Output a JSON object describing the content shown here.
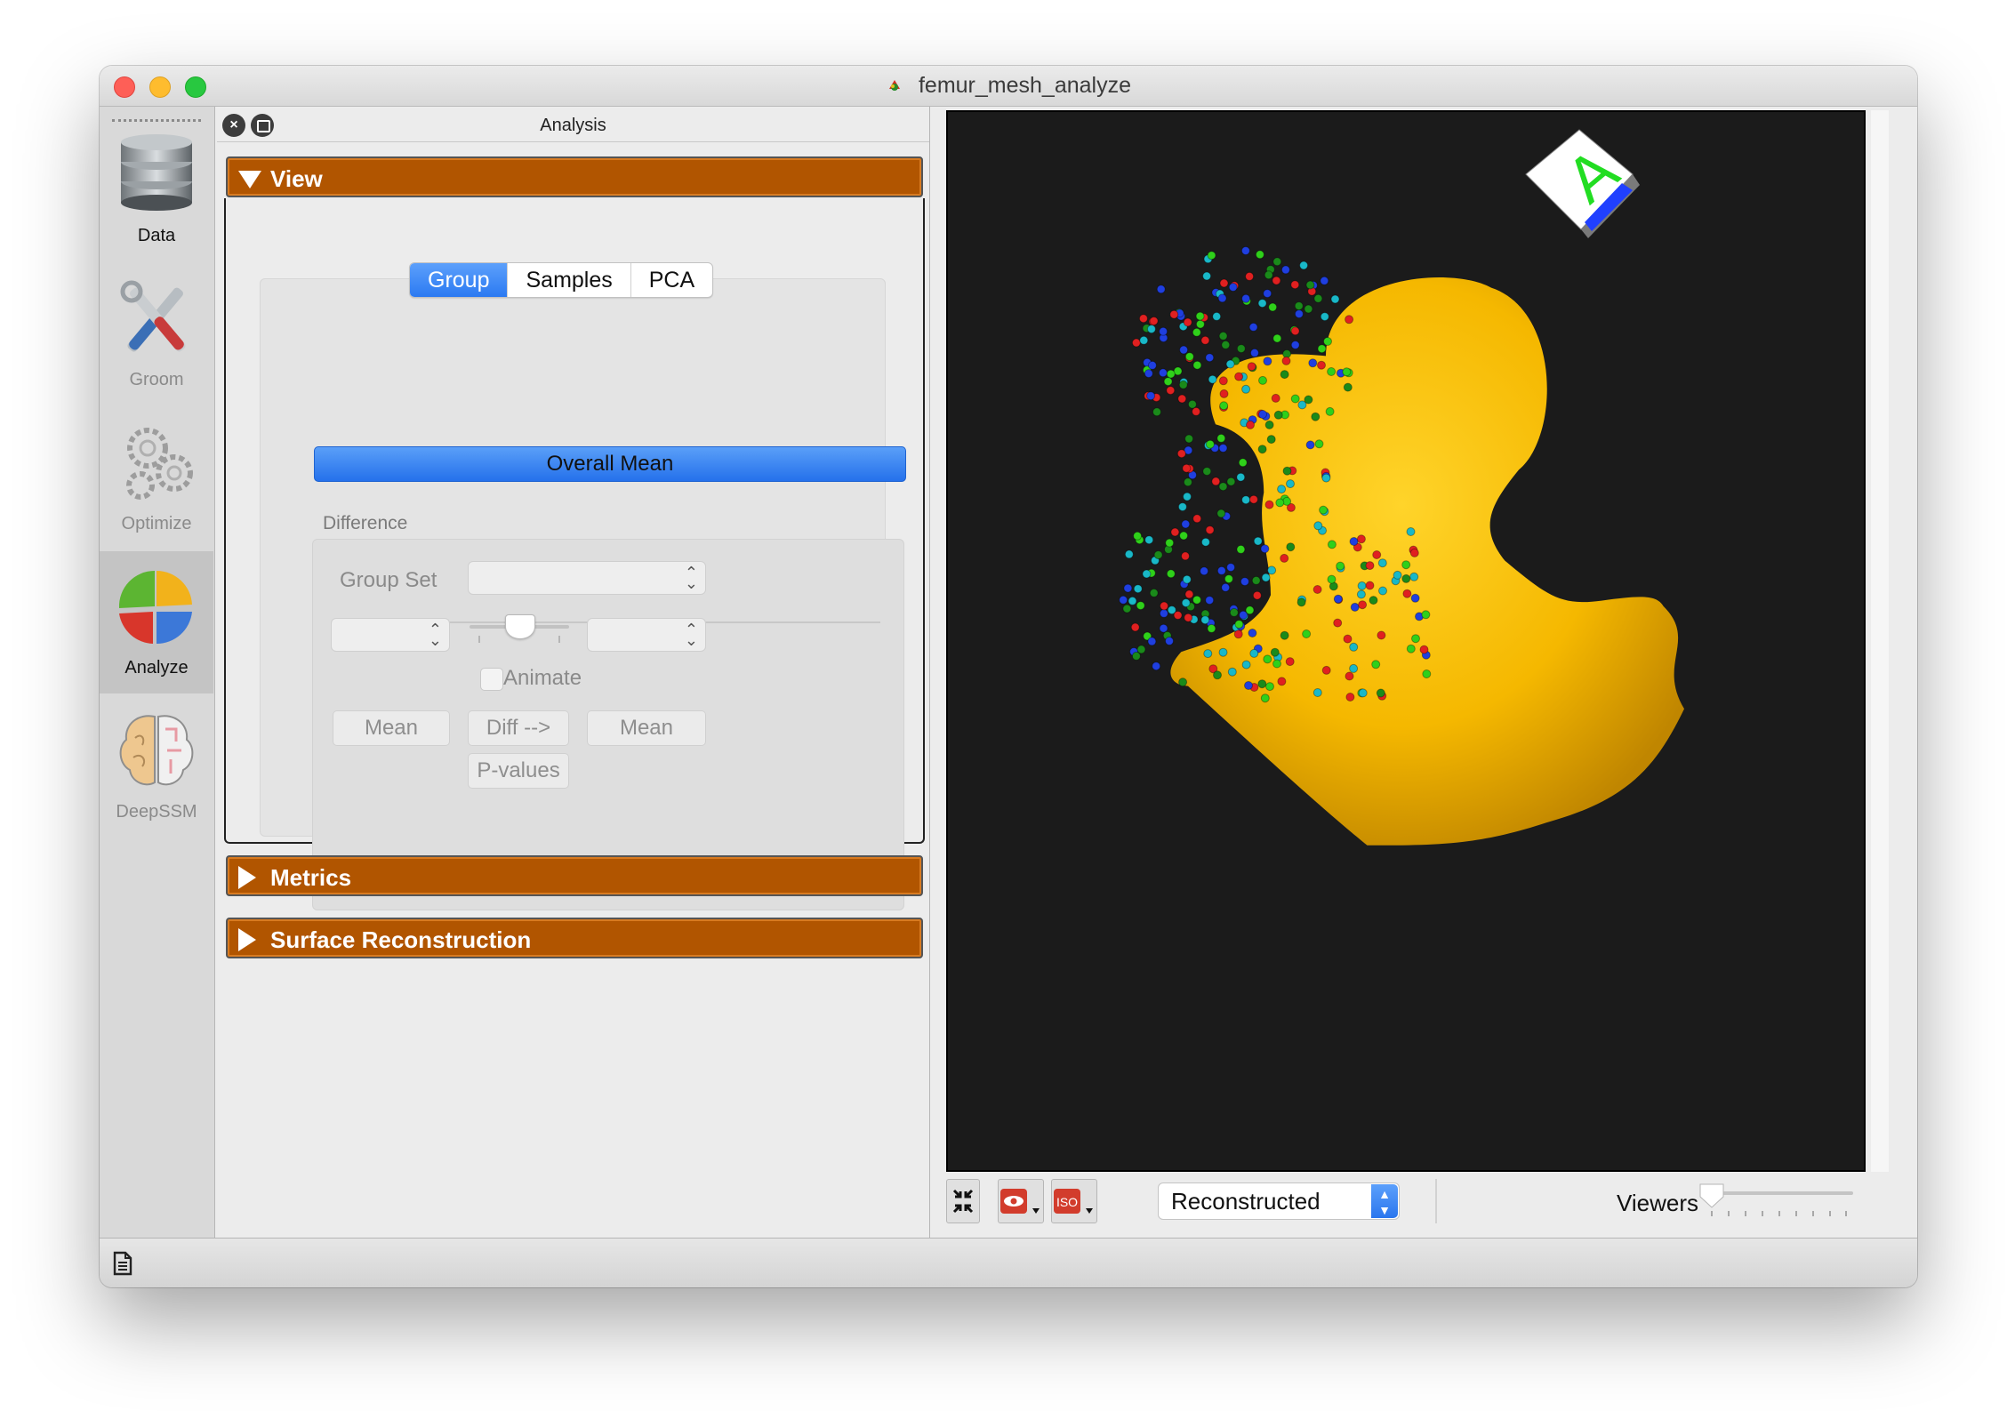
{
  "window": {
    "title": "femur_mesh_analyze"
  },
  "modules": [
    {
      "label": "Data",
      "active": false,
      "enabled": true
    },
    {
      "label": "Groom",
      "active": false,
      "enabled": false
    },
    {
      "label": "Optimize",
      "active": false,
      "enabled": false
    },
    {
      "label": "Analyze",
      "active": true,
      "enabled": true
    },
    {
      "label": "DeepSSM",
      "active": false,
      "enabled": false
    }
  ],
  "panel": {
    "title": "Analysis",
    "sections": {
      "view": "View",
      "metrics": "Metrics",
      "surface": "Surface Reconstruction"
    },
    "tabs": [
      "Group",
      "Samples",
      "PCA"
    ],
    "selected_tab": "Group",
    "overall_mean": "Overall Mean",
    "difference": {
      "label": "Difference",
      "group_set_label": "Group Set",
      "group_set_value": "",
      "left_group": "",
      "right_group": "",
      "animate_label": "Animate",
      "animate_checked": false,
      "mean_left": "Mean",
      "diff": "Diff -->",
      "mean_right": "Mean",
      "pvalues": "P-values"
    }
  },
  "viewer": {
    "display_mode": "Reconstructed",
    "viewers_label": "Viewers",
    "orientation_marker": "A",
    "colors": {
      "background": "#1b1b1b",
      "surface": "#f5b800",
      "marker_face": "#ffffff",
      "marker_letter": "#22dd22"
    },
    "particle_colors": [
      "#e02020",
      "#1a8a1a",
      "#1f3fe0",
      "#19b8c8",
      "#2fd01a"
    ]
  },
  "icons": {
    "close_panel": "close-icon",
    "float_panel": "float-icon",
    "zoom_fit": "zoom-fit-icon",
    "eye": "eye-icon",
    "iso": "iso-icon",
    "log": "document-icon"
  }
}
